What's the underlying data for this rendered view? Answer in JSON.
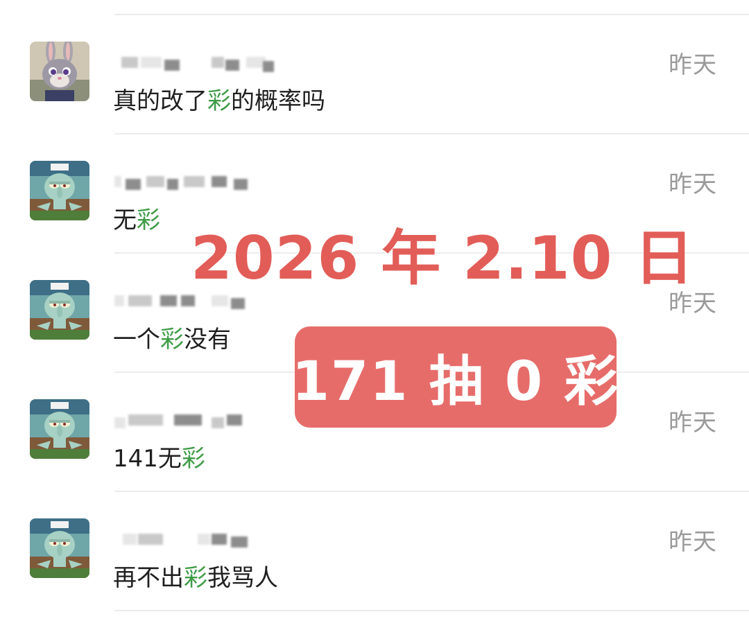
{
  "comments": [
    {
      "avatar": "judy-hopps-avatar",
      "time": "昨天",
      "pre": "真的改了",
      "hl": "彩",
      "post": "的概率吗"
    },
    {
      "avatar": "squidward-avatar",
      "time": "昨天",
      "pre": "无",
      "hl": "彩",
      "post": ""
    },
    {
      "avatar": "squidward-avatar",
      "time": "昨天",
      "pre": "一个",
      "hl": "彩",
      "post": "没有"
    },
    {
      "avatar": "squidward-avatar",
      "time": "昨天",
      "pre": "141无",
      "hl": "彩",
      "post": ""
    },
    {
      "avatar": "squidward-avatar",
      "time": "昨天",
      "pre": "再不出",
      "hl": "彩",
      "post": "我骂人"
    }
  ],
  "overlay": {
    "date_text": "2026 年 2.10 日",
    "badge_text": "171 抽 0 彩",
    "colors": {
      "date": "#e25d58",
      "badge": "#e66c6a",
      "highlight": "#3f9c47"
    }
  }
}
